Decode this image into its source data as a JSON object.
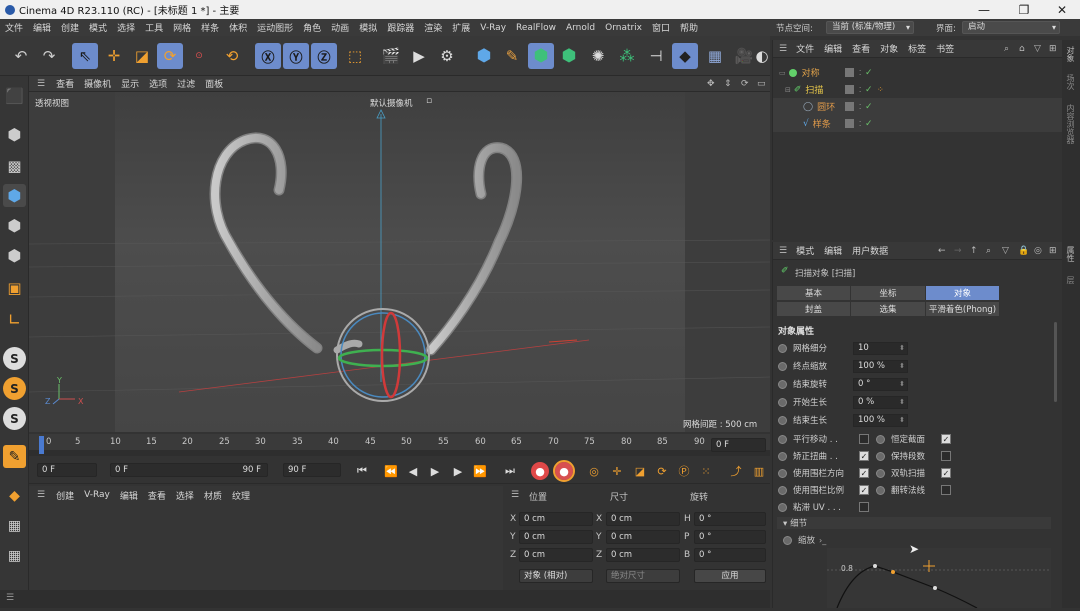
{
  "title": "Cinema 4D R23.110 (RC) - [未标题 1 *] - 主要",
  "menu": [
    "文件",
    "编辑",
    "创建",
    "模式",
    "选择",
    "工具",
    "网格",
    "样条",
    "体积",
    "运动图形",
    "角色",
    "动画",
    "模拟",
    "跟踪器",
    "渲染",
    "扩展",
    "V-Ray",
    "RealFlow",
    "Arnold",
    "Ornatrix",
    "窗口",
    "帮助"
  ],
  "node_space_label": "节点空间:",
  "node_space_value": "当前 (标准/物理)",
  "interface_label": "界面:",
  "interface_value": "启动",
  "viewport_menu": [
    "查看",
    "摄像机",
    "显示",
    "选项",
    "过滤",
    "面板"
  ],
  "viewport_name": "透视视图",
  "camera_label": "默认摄像机",
  "grid_spacing": "网格间距 : 500 cm",
  "timeline": {
    "ticks": [
      "0",
      "5",
      "10",
      "15",
      "20",
      "25",
      "30",
      "35",
      "40",
      "45",
      "50",
      "55",
      "60",
      "65",
      "70",
      "75",
      "80",
      "85",
      "90"
    ],
    "current_frame": "0 F"
  },
  "transport": {
    "start": "0 F",
    "range_start": "0 F",
    "range_end": "90 F",
    "end": "90 F"
  },
  "material_menu": [
    "创建",
    "V-Ray",
    "编辑",
    "查看",
    "选择",
    "材质",
    "纹理"
  ],
  "coords": {
    "headers": [
      "位置",
      "尺寸",
      "旋转"
    ],
    "rows": [
      {
        "a": "X",
        "pos": "0 cm",
        "b": "X",
        "size": "0 cm",
        "c": "H",
        "rot": "0 °"
      },
      {
        "a": "Y",
        "pos": "0 cm",
        "b": "Y",
        "size": "0 cm",
        "c": "P",
        "rot": "0 °"
      },
      {
        "a": "Z",
        "pos": "0 cm",
        "b": "Z",
        "size": "0 cm",
        "c": "B",
        "rot": "0 °"
      }
    ],
    "mode": "对象 (相对)",
    "size_mode": "绝对尺寸",
    "apply": "应用"
  },
  "object_manager": {
    "menu": [
      "文件",
      "编辑",
      "查看",
      "对象",
      "标签",
      "书签"
    ],
    "objects": [
      {
        "name": "对称",
        "color": "#e0a24a"
      },
      {
        "name": "扫描",
        "color": "#e8c84a"
      },
      {
        "name": "圆环",
        "color": "#e09a4a"
      },
      {
        "name": "样条",
        "color": "#e09a4a"
      }
    ]
  },
  "attributes": {
    "menu": [
      "模式",
      "编辑",
      "用户数据"
    ],
    "object_title": "扫描对象 [扫描]",
    "tabs_row1": [
      "基本",
      "坐标",
      "对象"
    ],
    "tabs_row2": [
      "封盖",
      "选集",
      "平滑着色(Phong)"
    ],
    "active_tab": "对象",
    "section": "对象属性",
    "props": [
      {
        "label": "网格细分",
        "value": "10"
      },
      {
        "label": "终点缩放",
        "value": "100 %"
      },
      {
        "label": "结束旋转",
        "value": "0 °"
      },
      {
        "label": "开始生长",
        "value": "0 %"
      },
      {
        "label": "结束生长",
        "value": "100 %"
      }
    ],
    "checks_left": [
      {
        "label": "平行移动 . .",
        "on": false
      },
      {
        "label": "矫正扭曲 . .",
        "on": true
      },
      {
        "label": "使用围栏方向",
        "on": true
      },
      {
        "label": "使用围栏比例",
        "on": true
      },
      {
        "label": "粘滞 UV . . .",
        "on": false
      }
    ],
    "checks_right": [
      {
        "label": "恒定截面",
        "on": true
      },
      {
        "label": "保持段数",
        "on": false
      },
      {
        "label": "双轨扫描",
        "on": true
      },
      {
        "label": "翻转法线",
        "on": false
      }
    ],
    "details_section": "细节",
    "scale_label": "缩放",
    "curve_value": "0.8"
  },
  "right_strip": [
    "对象",
    "场次",
    "内容浏览器",
    "属性",
    "层"
  ]
}
